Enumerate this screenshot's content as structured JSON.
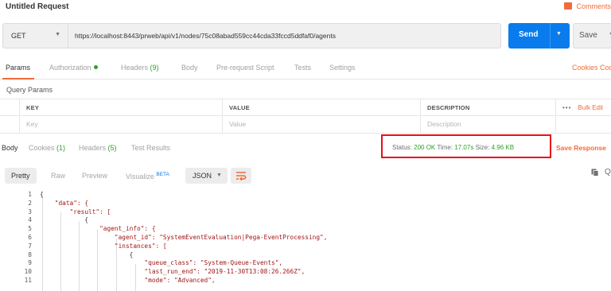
{
  "window": {
    "title": "Untitled Request",
    "comments_label": "Comments"
  },
  "request": {
    "method": "GET",
    "url": "https://localhost:8443/prweb/api/v1/nodes/75c08abad559cc44cda33fccd5ddfaf0/agents",
    "send_label": "Send",
    "save_label": "Save"
  },
  "request_tabs": [
    {
      "label": "Params",
      "active": true
    },
    {
      "label": "Authorization",
      "dot": true
    },
    {
      "label": "Headers",
      "count": "(9)"
    },
    {
      "label": "Body"
    },
    {
      "label": "Pre-request Script"
    },
    {
      "label": "Tests"
    },
    {
      "label": "Settings"
    }
  ],
  "cookies_link": "Cookies",
  "code_link": "Code",
  "query_params": {
    "title": "Query Params",
    "headers": [
      "KEY",
      "VALUE",
      "DESCRIPTION"
    ],
    "placeholders": [
      "Key",
      "Value",
      "Description"
    ],
    "more_label": "•••",
    "bulk_edit_label": "Bulk Edit"
  },
  "response_tabs": [
    {
      "label": "Body",
      "active": true
    },
    {
      "label": "Cookies",
      "count": "(1)"
    },
    {
      "label": "Headers",
      "count": "(5)"
    },
    {
      "label": "Test Results"
    }
  ],
  "status": {
    "status_label": "Status:",
    "status_value": "200 OK",
    "time_label": "Time:",
    "time_value": "17.07s",
    "size_label": "Size:",
    "size_value": "4.96 KB"
  },
  "save_response_label": "Save Response",
  "view": {
    "tabs": [
      "Pretty",
      "Raw",
      "Preview",
      "Visualize"
    ],
    "beta_label": "BETA",
    "format": "JSON"
  },
  "code_lines": [
    {
      "n": "1",
      "text": "{"
    },
    {
      "n": "2",
      "text": "    \"data\": {"
    },
    {
      "n": "3",
      "text": "        \"result\": ["
    },
    {
      "n": "4",
      "text": "            {"
    },
    {
      "n": "5",
      "text": "                \"agent_info\": {"
    },
    {
      "n": "6",
      "text": "                    \"agent_id\": \"SystemEventEvaluation|Pega-EventProcessing\","
    },
    {
      "n": "7",
      "text": "                    \"instances\": ["
    },
    {
      "n": "8",
      "text": "                        {"
    },
    {
      "n": "9",
      "text": "                            \"queue_class\": \"System-Queue-Events\","
    },
    {
      "n": "10",
      "text": "                            \"last_run_end\": \"2019-11-30T13:08:26.266Z\","
    },
    {
      "n": "11",
      "text": "                            \"mode\": \"Advanced\","
    }
  ],
  "colors": {
    "accent": "#f26b3a",
    "send_blue": "#097bed",
    "ok_green": "#29a329",
    "highlight_red": "#e8101a"
  },
  "icons": [
    "comment-icon",
    "chevron-down-icon",
    "wrap-lines-icon",
    "copy-icon",
    "search-icon"
  ]
}
